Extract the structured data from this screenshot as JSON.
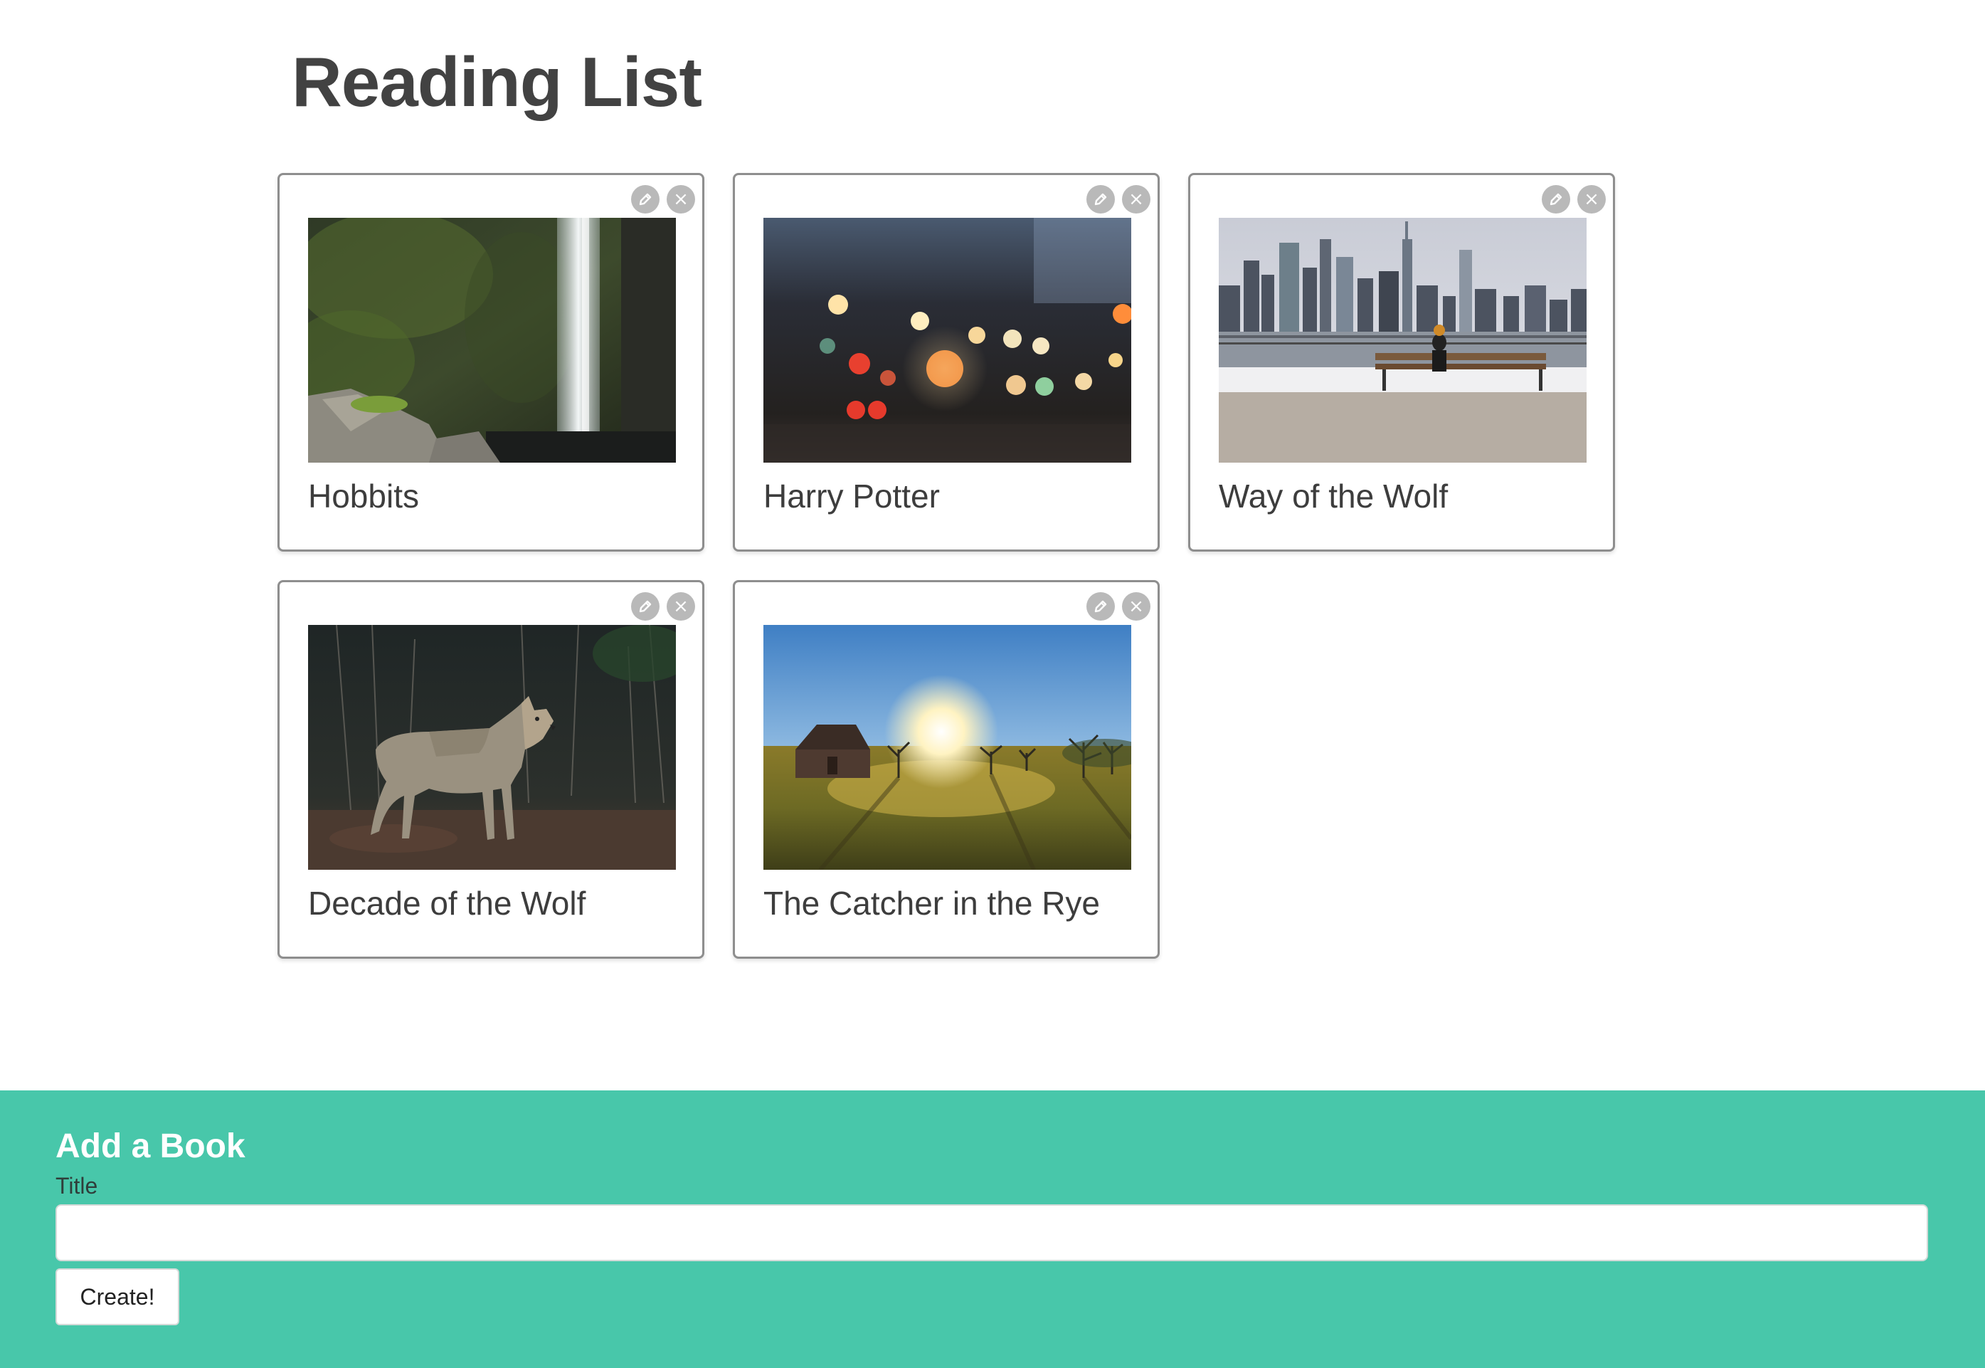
{
  "page": {
    "title": "Reading List"
  },
  "books": [
    {
      "title": "Hobbits",
      "image": "waterfall-photo"
    },
    {
      "title": "Harry Potter",
      "image": "bokeh-street-photo"
    },
    {
      "title": "Way of the Wolf",
      "image": "city-skyline-bench-photo"
    },
    {
      "title": "Decade of the Wolf",
      "image": "coyote-forest-photo"
    },
    {
      "title": "The Catcher in the Rye",
      "image": "sunrise-field-photo"
    }
  ],
  "card_actions": {
    "edit_icon": "pencil-icon",
    "delete_icon": "close-icon",
    "delete_glyph": "×"
  },
  "add_form": {
    "heading": "Add a Book",
    "title_label": "Title",
    "title_value": "",
    "title_placeholder": "",
    "submit_label": "Create!"
  },
  "colors": {
    "panel_background": "#48c7aa",
    "card_border": "#8e8e8e",
    "action_button": "#b9b9b9",
    "title_text": "#424242"
  }
}
